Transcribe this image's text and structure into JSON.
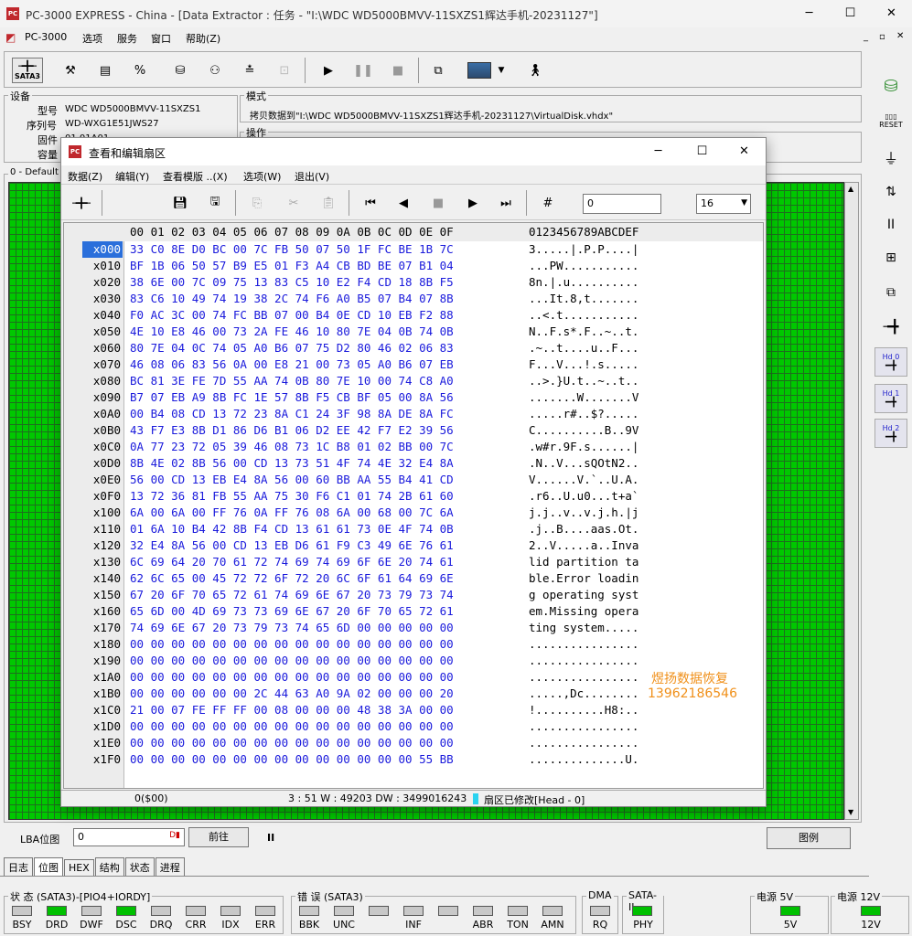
{
  "app": {
    "title": "PC-3000 EXPRESS - China - [Data Extractor : 任务 - \"I:\\WDC WD5000BMVV-11SXZS1辉达手机-20231127\"]",
    "logo": "PC",
    "minimize": "─",
    "maximize": "☐",
    "close": "✕"
  },
  "menu": {
    "app_label": "PC-3000",
    "items": [
      "选项",
      "服务",
      "窗口",
      "帮助(Z)"
    ]
  },
  "toolbar": {
    "sata_label": "SATA3"
  },
  "device": {
    "group_title": "设备",
    "model_label": "型号",
    "model_value": "WDC WD5000BMVV-11SXZS1",
    "serial_label": "序列号",
    "serial_value": "WD-WXG1E51JWS27",
    "fw_label": "固件",
    "fw_value": "01.01A01",
    "capacity_label": "容量"
  },
  "mode": {
    "group_title": "模式",
    "value": "拷贝数据到\"I:\\WDC WD5000BMVV-11SXZS1辉达手机-20231127\\VirtualDisk.vhdx\"",
    "op_title": "操作"
  },
  "map": {
    "group_title": "0 - Default"
  },
  "dialog": {
    "title": "查看和编辑扇区",
    "logo": "PC",
    "minimize": "─",
    "maximize": "☐",
    "close": "✕",
    "menu": [
      "数据(Z)",
      "编辑(Y)",
      "查看模版 ..(X)",
      "选项(W)",
      "退出(V)"
    ],
    "offset_value": "0",
    "cols_value": "16",
    "header_bytes": "00 01 02 03 04 05 06 07 08 09 0A 0B 0C 0D 0E 0F",
    "header_ascii": "0123456789ABCDEF",
    "rows": [
      {
        "addr": "x000",
        "bytes": "33 C0 8E D0 BC 00 7C FB 50 07 50 1F FC BE 1B 7C",
        "ascii": "3.....|.P.P....|"
      },
      {
        "addr": "x010",
        "bytes": "BF 1B 06 50 57 B9 E5 01 F3 A4 CB BD BE 07 B1 04",
        "ascii": "...PW..........."
      },
      {
        "addr": "x020",
        "bytes": "38 6E 00 7C 09 75 13 83 C5 10 E2 F4 CD 18 8B F5",
        "ascii": "8n.|.u.........."
      },
      {
        "addr": "x030",
        "bytes": "83 C6 10 49 74 19 38 2C 74 F6 A0 B5 07 B4 07 8B",
        "ascii": "...It.8,t......."
      },
      {
        "addr": "x040",
        "bytes": "F0 AC 3C 00 74 FC BB 07 00 B4 0E CD 10 EB F2 88",
        "ascii": "..<.t..........."
      },
      {
        "addr": "x050",
        "bytes": "4E 10 E8 46 00 73 2A FE 46 10 80 7E 04 0B 74 0B",
        "ascii": "N..F.s*.F..~..t."
      },
      {
        "addr": "x060",
        "bytes": "80 7E 04 0C 74 05 A0 B6 07 75 D2 80 46 02 06 83",
        "ascii": ".~..t....u..F..."
      },
      {
        "addr": "x070",
        "bytes": "46 08 06 83 56 0A 00 E8 21 00 73 05 A0 B6 07 EB",
        "ascii": "F...V...!.s....."
      },
      {
        "addr": "x080",
        "bytes": "BC 81 3E FE 7D 55 AA 74 0B 80 7E 10 00 74 C8 A0",
        "ascii": "..>.}U.t..~..t.."
      },
      {
        "addr": "x090",
        "bytes": "B7 07 EB A9 8B FC 1E 57 8B F5 CB BF 05 00 8A 56",
        "ascii": ".......W.......V"
      },
      {
        "addr": "x0A0",
        "bytes": "00 B4 08 CD 13 72 23 8A C1 24 3F 98 8A DE 8A FC",
        "ascii": ".....r#..$?....."
      },
      {
        "addr": "x0B0",
        "bytes": "43 F7 E3 8B D1 86 D6 B1 06 D2 EE 42 F7 E2 39 56",
        "ascii": "C..........B..9V"
      },
      {
        "addr": "x0C0",
        "bytes": "0A 77 23 72 05 39 46 08 73 1C B8 01 02 BB 00 7C",
        "ascii": ".w#r.9F.s......|"
      },
      {
        "addr": "x0D0",
        "bytes": "8B 4E 02 8B 56 00 CD 13 73 51 4F 74 4E 32 E4 8A",
        "ascii": ".N..V...sQOtN2.."
      },
      {
        "addr": "x0E0",
        "bytes": "56 00 CD 13 EB E4 8A 56 00 60 BB AA 55 B4 41 CD",
        "ascii": "V......V.`..U.A."
      },
      {
        "addr": "x0F0",
        "bytes": "13 72 36 81 FB 55 AA 75 30 F6 C1 01 74 2B 61 60",
        "ascii": ".r6..U.u0...t+a`"
      },
      {
        "addr": "x100",
        "bytes": "6A 00 6A 00 FF 76 0A FF 76 08 6A 00 68 00 7C 6A",
        "ascii": "j.j..v..v.j.h.|j"
      },
      {
        "addr": "x110",
        "bytes": "01 6A 10 B4 42 8B F4 CD 13 61 61 73 0E 4F 74 0B",
        "ascii": ".j..B....aas.Ot."
      },
      {
        "addr": "x120",
        "bytes": "32 E4 8A 56 00 CD 13 EB D6 61 F9 C3 49 6E 76 61",
        "ascii": "2..V.....a..Inva"
      },
      {
        "addr": "x130",
        "bytes": "6C 69 64 20 70 61 72 74 69 74 69 6F 6E 20 74 61",
        "ascii": "lid partition ta"
      },
      {
        "addr": "x140",
        "bytes": "62 6C 65 00 45 72 72 6F 72 20 6C 6F 61 64 69 6E",
        "ascii": "ble.Error loadin"
      },
      {
        "addr": "x150",
        "bytes": "67 20 6F 70 65 72 61 74 69 6E 67 20 73 79 73 74",
        "ascii": "g operating syst"
      },
      {
        "addr": "x160",
        "bytes": "65 6D 00 4D 69 73 73 69 6E 67 20 6F 70 65 72 61",
        "ascii": "em.Missing opera"
      },
      {
        "addr": "x170",
        "bytes": "74 69 6E 67 20 73 79 73 74 65 6D 00 00 00 00 00",
        "ascii": "ting system....."
      },
      {
        "addr": "x180",
        "bytes": "00 00 00 00 00 00 00 00 00 00 00 00 00 00 00 00",
        "ascii": "................"
      },
      {
        "addr": "x190",
        "bytes": "00 00 00 00 00 00 00 00 00 00 00 00 00 00 00 00",
        "ascii": "................"
      },
      {
        "addr": "x1A0",
        "bytes": "00 00 00 00 00 00 00 00 00 00 00 00 00 00 00 00",
        "ascii": "................"
      },
      {
        "addr": "x1B0",
        "bytes": "00 00 00 00 00 00 2C 44 63 A0 9A 02 00 00 00 20",
        "ascii": ".....,Dc........"
      },
      {
        "addr": "x1C0",
        "bytes": "21 00 07 FE FF FF 00 08 00 00 00 48 38 3A 00 00",
        "ascii": "!..........H8:.."
      },
      {
        "addr": "x1D0",
        "bytes": "00 00 00 00 00 00 00 00 00 00 00 00 00 00 00 00",
        "ascii": "................"
      },
      {
        "addr": "x1E0",
        "bytes": "00 00 00 00 00 00 00 00 00 00 00 00 00 00 00 00",
        "ascii": "................"
      },
      {
        "addr": "x1F0",
        "bytes": "00 00 00 00 00 00 00 00 00 00 00 00 00 00 55 BB",
        "ascii": "..............U."
      }
    ],
    "status_pos": "0($00)",
    "status_info": "3 : 51 W : 49203 DW : 3499016243",
    "status_modified": "扇区已修改[Head - 0]"
  },
  "watermark": {
    "line1": "煜扬数据恢复",
    "line2": "13962186546"
  },
  "lba": {
    "label": "LBA位图",
    "value": "0",
    "go_label": "前往",
    "pause": "II",
    "legend_label": "图例"
  },
  "tabs": [
    "日志",
    "位图",
    "HEX",
    "结构",
    "状态",
    "进程"
  ],
  "status": {
    "group1_title": "状 态 (SATA3)-[PIO4+IORDY]",
    "leds1": [
      {
        "label": "BSY",
        "on": false
      },
      {
        "label": "DRD",
        "on": true
      },
      {
        "label": "DWF",
        "on": false
      },
      {
        "label": "DSC",
        "on": true
      },
      {
        "label": "DRQ",
        "on": false
      },
      {
        "label": "CRR",
        "on": false
      },
      {
        "label": "IDX",
        "on": false
      },
      {
        "label": "ERR",
        "on": false
      }
    ],
    "group2_title": "错 误 (SATA3)",
    "leds2": [
      {
        "label": "BBK",
        "on": false
      },
      {
        "label": "UNC",
        "on": false
      },
      {
        "label": "",
        "on": false
      },
      {
        "label": "INF",
        "on": false
      },
      {
        "label": "",
        "on": false
      },
      {
        "label": "ABR",
        "on": false
      },
      {
        "label": "TON",
        "on": false
      },
      {
        "label": "AMN",
        "on": false
      }
    ],
    "dma_title": "DMA",
    "dma_led": "RQ",
    "sata_title": "SATA-II",
    "sata_led": "PHY",
    "power5_title": "电源 5V",
    "power5_led": "5V",
    "power12_title": "电源 12V",
    "power12_led": "12V"
  },
  "right_panel": {
    "reset": "RESET",
    "hd0": "Hd 0",
    "hd1": "Hd 1",
    "hd2": "Hd 2",
    "pause": "II"
  }
}
